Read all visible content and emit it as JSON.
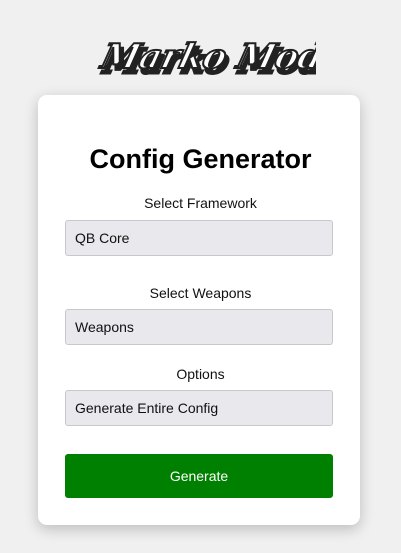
{
  "logo": {
    "text": "Marko Mods"
  },
  "form": {
    "title": "Config Generator",
    "framework_label": "Select Framework",
    "framework_value": "QB Core",
    "weapons_label": "Select Weapons",
    "weapons_value": "Weapons",
    "options_label": "Options",
    "options_value": "Generate Entire Config",
    "generate_label": "Generate"
  },
  "colors": {
    "background": "#f0f0f0",
    "card": "#ffffff",
    "field": "#e8e8ed",
    "button": "#008000",
    "button_text": "#ffffff"
  }
}
